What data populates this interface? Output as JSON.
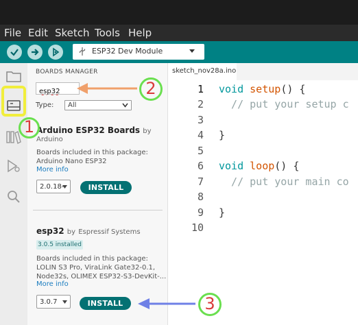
{
  "menu": {
    "file": "File",
    "edit": "Edit",
    "sketch": "Sketch",
    "tools": "Tools",
    "help": "Help"
  },
  "toolbar": {
    "board": "ESP32 Dev Module"
  },
  "boards_manager": {
    "title": "BOARDS MANAGER",
    "search_value": "esp32",
    "type_label": "Type:",
    "type_value": "All",
    "boards": [
      {
        "name": "Arduino ESP32 Boards",
        "by": "by",
        "author": "Arduino",
        "desc_line1": "Boards included in this package:",
        "desc_line2": "Arduino Nano ESP32",
        "more": "More info",
        "version": "2.0.18-",
        "install": "INSTALL"
      },
      {
        "name": "esp32",
        "by": "by",
        "author": "Espressif Systems",
        "installed": "3.0.5 installed",
        "desc_line1": "Boards included in this package:",
        "desc_line2": "LOLIN S3 Pro, ViraLink Gate32-0.1,",
        "desc_line3": "Node32s, OLIMEX ESP32-S3-DevKit-...",
        "more": "More info",
        "version": "3.0.7",
        "install": "INSTALL"
      }
    ]
  },
  "editor": {
    "tab": "sketch_nov28a.ino",
    "line_numbers": [
      "1",
      "2",
      "3",
      "4",
      "5",
      "6",
      "7",
      "8",
      "9",
      "10"
    ],
    "code": {
      "l1_kw": "void",
      "l1_fn": "setup",
      "l1_rest": "() {",
      "l2": "  // put your setup c",
      "l4": "}",
      "l6_kw": "void",
      "l6_fn": "loop",
      "l6_rest": "() {",
      "l7": "  // put your main co",
      "l9": "}"
    }
  },
  "annotations": {
    "a1": "1",
    "a2": "2",
    "a3": "3"
  },
  "colors": {
    "toolbar": "#008184",
    "install": "#047173",
    "highlight": "#f1ee3c",
    "annotation_circle": "#6adf4f",
    "annotation_number": "#d93a3a",
    "arrow_orange": "#f0a06b",
    "arrow_blue": "#6f80e6"
  }
}
